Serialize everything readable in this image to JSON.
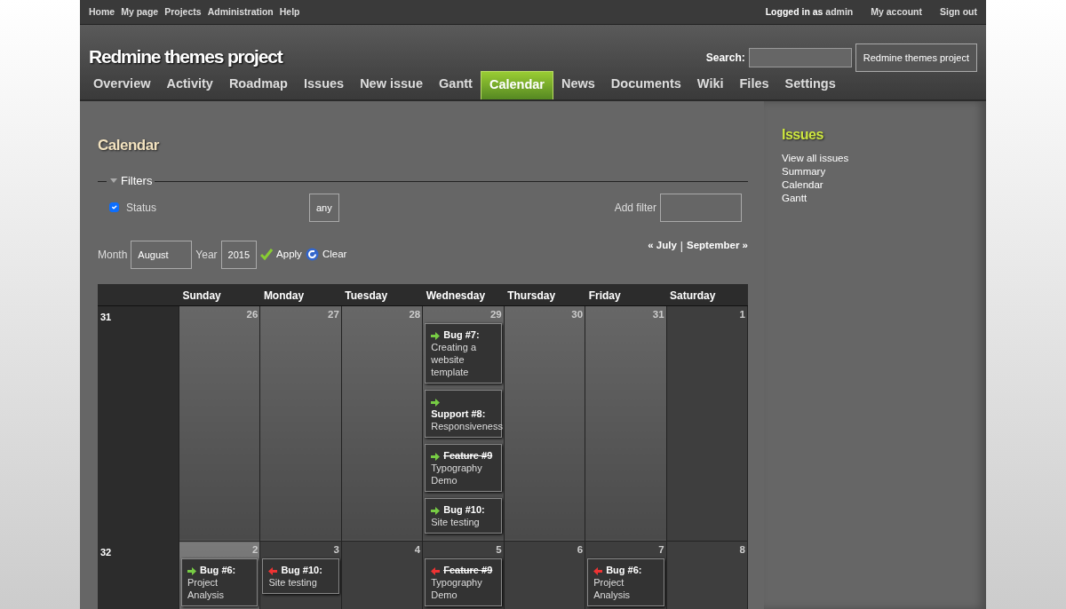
{
  "top_menu": {
    "left": [
      "Home",
      "My page",
      "Projects",
      "Administration",
      "Help"
    ],
    "logged_in": {
      "prefix": "Logged in as",
      "user": "admin"
    },
    "right": [
      "My account",
      "Sign out"
    ]
  },
  "header": {
    "title": "Redmine themes project",
    "search_label": "Search:",
    "project_button": "Redmine themes project"
  },
  "main_menu": [
    {
      "label": "Overview",
      "selected": false
    },
    {
      "label": "Activity",
      "selected": false
    },
    {
      "label": "Roadmap",
      "selected": false
    },
    {
      "label": "Issues",
      "selected": false
    },
    {
      "label": "New issue",
      "selected": false
    },
    {
      "label": "Gantt",
      "selected": false
    },
    {
      "label": "Calendar",
      "selected": true
    },
    {
      "label": "News",
      "selected": false
    },
    {
      "label": "Documents",
      "selected": false
    },
    {
      "label": "Wiki",
      "selected": false
    },
    {
      "label": "Files",
      "selected": false
    },
    {
      "label": "Settings",
      "selected": false
    }
  ],
  "page_title": "Calendar",
  "filters": {
    "legend": "Filters",
    "expanded": true,
    "status": {
      "label": "Status",
      "checked": true,
      "value": "any"
    },
    "add_filter_label": "Add filter"
  },
  "period": {
    "month_label": "Month",
    "month": "August",
    "year_label": "Year",
    "year": "2015",
    "apply": "Apply",
    "clear": "Clear",
    "prev": "« July",
    "separator": "|",
    "next": "September »"
  },
  "calendar": {
    "days": [
      "Sunday",
      "Monday",
      "Tuesday",
      "Wednesday",
      "Thursday",
      "Friday",
      "Saturday"
    ],
    "weeks": [
      {
        "number": "31",
        "cells": [
          {
            "day": "26",
            "other_month": true,
            "today": false
          },
          {
            "day": "27",
            "other_month": true,
            "today": false
          },
          {
            "day": "28",
            "other_month": true,
            "today": false
          },
          {
            "day": "29",
            "other_month": true,
            "today": false,
            "issues": [
              {
                "kind": "start",
                "ref": "Bug #7:",
                "subject": "Creating a website template",
                "closed": false
              },
              {
                "kind": "start",
                "ref": "Support #8:",
                "subject": "Responsiveness",
                "closed": false
              },
              {
                "kind": "start",
                "ref": "Feature #9",
                "subject": "Typography Demo",
                "closed": true
              },
              {
                "kind": "start",
                "ref": "Bug #10:",
                "subject": "Site testing",
                "closed": false
              }
            ]
          },
          {
            "day": "30",
            "other_month": true,
            "today": false
          },
          {
            "day": "31",
            "other_month": true,
            "today": false
          },
          {
            "day": "1",
            "other_month": false,
            "today": false
          }
        ]
      },
      {
        "number": "32",
        "cells": [
          {
            "day": "2",
            "other_month": false,
            "today": true,
            "issues": [
              {
                "kind": "start",
                "ref": "Bug #6:",
                "subject": "Project Analysis",
                "closed": false
              }
            ]
          },
          {
            "day": "3",
            "other_month": false,
            "today": false,
            "issues": [
              {
                "kind": "end",
                "ref": "Bug #10:",
                "subject": "Site testing",
                "closed": false
              }
            ]
          },
          {
            "day": "4",
            "other_month": false,
            "today": false
          },
          {
            "day": "5",
            "other_month": false,
            "today": false,
            "issues": [
              {
                "kind": "end",
                "ref": "Feature #9",
                "subject": "Typography Demo",
                "closed": true
              }
            ]
          },
          {
            "day": "6",
            "other_month": false,
            "today": false
          },
          {
            "day": "7",
            "other_month": false,
            "today": false,
            "issues": [
              {
                "kind": "end",
                "ref": "Bug #6:",
                "subject": "Project Analysis",
                "closed": false
              }
            ]
          },
          {
            "day": "8",
            "other_month": false,
            "today": false
          }
        ]
      }
    ]
  },
  "sidebar": {
    "title": "Issues",
    "links": [
      "View all issues",
      "Summary",
      "Calendar",
      "Gantt"
    ]
  }
}
